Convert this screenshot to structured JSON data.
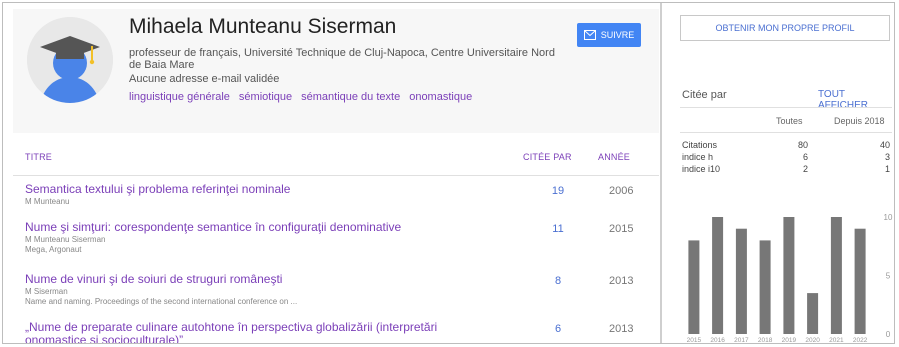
{
  "profile": {
    "name": "Mihaela Munteanu Siserman",
    "affiliation": "professeur de français, Université Technique de Cluj-Napoca, Centre Universitaire Nord de Baia Mare",
    "email_status": "Aucune adresse e-mail validée",
    "interests": [
      "linguistique générale",
      "sémiotique",
      "sémantique du texte",
      "onomastique"
    ],
    "follow_label": "SUIVRE",
    "avatar_icon": "graduation-cap-avatar-icon"
  },
  "table": {
    "headers": {
      "title": "TITRE",
      "cited_by": "CITÉE PAR",
      "year": "ANNÉE"
    },
    "rows": [
      {
        "title": "Semantica textului şi problema referinţei nominale",
        "authors": "M Munteanu",
        "venue": "",
        "cited_by": "19",
        "year": "2006"
      },
      {
        "title": "Nume şi simţuri: corespondenţe semantice în configuraţii denominative",
        "authors": "M Munteanu Siserman",
        "venue": "Mega, Argonaut",
        "cited_by": "11",
        "year": "2015"
      },
      {
        "title": "Nume de vinuri şi de soiuri de struguri româneşti",
        "authors": "M Siserman",
        "venue": "Name and naming. Proceedings of the second international conference on ...",
        "cited_by": "8",
        "year": "2013"
      },
      {
        "title": "„Nume de preparate culinare autohtone în perspectiva globalizării (interpretări onomastice şi socioculturale)”",
        "authors": "",
        "venue": "",
        "cited_by": "6",
        "year": "2013"
      }
    ]
  },
  "sidebar": {
    "own_profile_label": "OBTENIR MON PROPRE PROFIL",
    "cited_by_label": "Citée par",
    "show_all_label": "TOUT AFFICHER",
    "columns": {
      "all": "Toutes",
      "since": "Depuis 2018"
    },
    "stats": [
      {
        "label": "Citations",
        "all": "80",
        "since": "40"
      },
      {
        "label": "indice h",
        "all": "6",
        "since": "3"
      },
      {
        "label": "indice i10",
        "all": "2",
        "since": "1"
      }
    ]
  },
  "chart_data": {
    "type": "bar",
    "categories": [
      "2015",
      "2016",
      "2017",
      "2018",
      "2019",
      "2020",
      "2021",
      "2022"
    ],
    "values": [
      8,
      10,
      9,
      8,
      10,
      3.5,
      10,
      9
    ],
    "yticks": [
      "10",
      "5",
      "0"
    ],
    "ylim": [
      0,
      10
    ],
    "bar_color": "#777777"
  },
  "colors": {
    "link_purple": "#7b3fb8",
    "link_blue": "#4a6fd1",
    "button_blue": "#4285f4"
  }
}
